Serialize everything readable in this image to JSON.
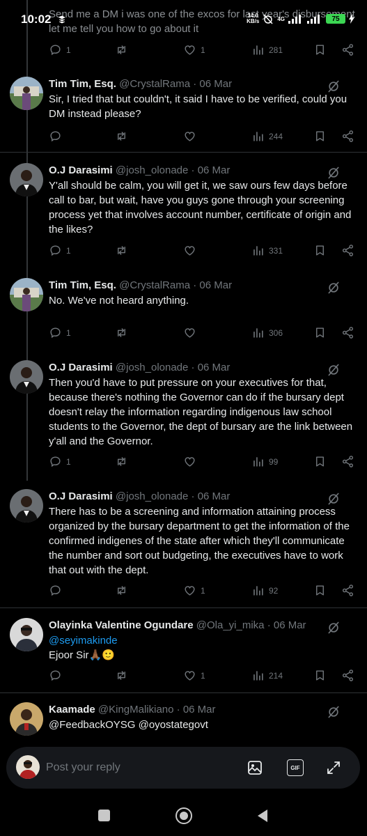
{
  "status_bar": {
    "time": "10:02",
    "net_speed_top": "34.0",
    "net_speed_bottom": "KB/s",
    "network_type": "4G",
    "battery": "75"
  },
  "top_tweet": {
    "text": "Send me a DM i was one of the excos for last year's disbursement let me tell you how to go about it",
    "replies": "1",
    "likes": "1",
    "views": "281"
  },
  "tweets": [
    {
      "name": "Tim Tim, Esq.",
      "handle": "@CrystalRama",
      "date": "· 06 Mar",
      "text": "Sir, I tried that but couldn't, it said I have to be verified, could you DM instead please?",
      "replies": "",
      "likes": "",
      "views": "244"
    },
    {
      "name": "O.J Darasimi",
      "handle": "@josh_olonade",
      "date": "· 06 Mar",
      "text": "Y'all should be calm, you will get it, we saw ours few days before call to bar, but wait, have you guys gone through your screening process yet that involves account number, certificate of origin and the likes?",
      "replies": "1",
      "likes": "",
      "views": "331"
    },
    {
      "name": "Tim Tim, Esq.",
      "handle": "@CrystalRama",
      "date": "· 06 Mar",
      "text": "No. We've not heard anything.",
      "replies": "1",
      "likes": "",
      "views": "306"
    },
    {
      "name": "O.J Darasimi",
      "handle": "@josh_olonade",
      "date": "· 06 Mar",
      "text": "Then you'd have to put pressure on your executives for that, because there's nothing the Governor can do if the bursary dept doesn't relay the information regarding indigenous law school students to the Governor, the dept of bursary are the link between y'all and the Governor.",
      "replies": "1",
      "likes": "",
      "views": "99"
    },
    {
      "name": "O.J Darasimi",
      "handle": "@josh_olonade",
      "date": "· 06 Mar",
      "text": "There has to be a screening and information attaining process organized by the bursary department to get the information of the confirmed indigenes of the state after which they'll communicate the number and sort out budgeting, the executives have to work that out with the dept.",
      "replies": "",
      "likes": "1",
      "views": "92"
    },
    {
      "name": "Olayinka Valentine Ogundare",
      "handle": "@Ola_yi_mika",
      "date": "· 06 Mar",
      "mention": "@seyimakinde",
      "text": "Ejoor Sir🙏🏾🙂",
      "replies": "",
      "likes": "1",
      "views": "214"
    },
    {
      "name": "Kaamade",
      "handle": "@KingMalikiano",
      "date": "· 06 Mar",
      "mention": "@FeedbackOYSG @oyostategovt"
    }
  ],
  "reply_bar": {
    "placeholder": "Post your reply",
    "gif_label": "GIF"
  },
  "colors": {
    "background": "#000000",
    "text": "#e7e9ea",
    "muted": "#71767b",
    "link": "#1d9bf0",
    "battery": "#3cd653"
  }
}
